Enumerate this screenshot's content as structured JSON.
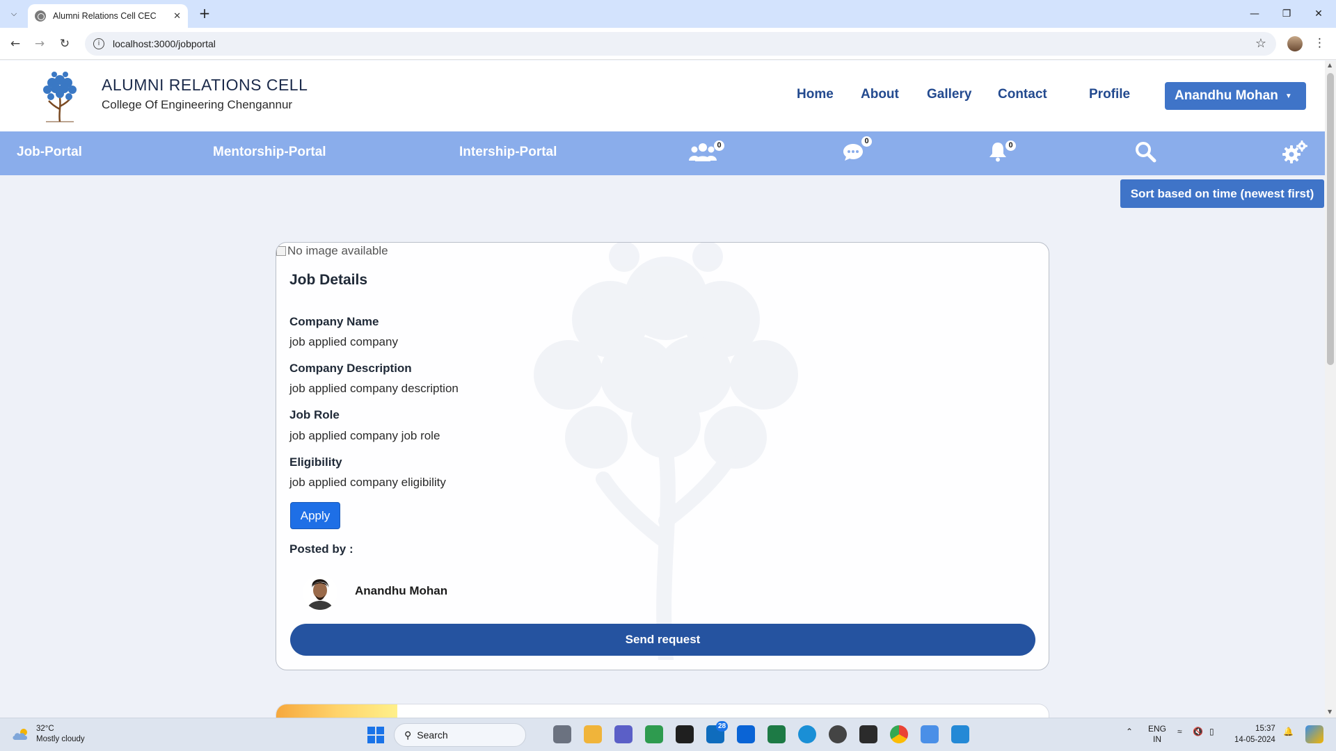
{
  "browser": {
    "tab_title": "Alumni Relations Cell CEC",
    "url": "localhost:3000/jobportal"
  },
  "header": {
    "brand_title": "ALUMNI RELATIONS CELL",
    "brand_subtitle": "College Of Engineering Chengannur",
    "nav": [
      "Home",
      "About",
      "Gallery",
      "Contact",
      "Profile"
    ],
    "user_name": "Anandhu Mohan"
  },
  "portal_bar": {
    "links": [
      "Job-Portal",
      "Mentorship-Portal",
      "Intership-Portal"
    ],
    "connections_count": "0",
    "messages_count": "0",
    "notifications_count": "0",
    "icons": [
      "users-icon",
      "chat-icon",
      "bell-icon",
      "search-icon",
      "gears-icon"
    ]
  },
  "sort_button": "Sort based on time (newest first)",
  "job_card": {
    "image_alt": "No image available",
    "title": "Job Details",
    "fields": [
      {
        "label": "Company Name",
        "value": "job applied company"
      },
      {
        "label": "Company Description",
        "value": "job applied company description"
      },
      {
        "label": "Job Role",
        "value": "job applied company job role"
      },
      {
        "label": "Eligibility",
        "value": "job applied company eligibility"
      }
    ],
    "apply_label": "Apply",
    "posted_by_label": "Posted by :",
    "poster_name": "Anandhu Mohan",
    "send_request_label": "Send request"
  },
  "taskbar": {
    "weather_temp": "32°C",
    "weather_desc": "Mostly cloudy",
    "search_placeholder": "Search",
    "mail_badge": "28",
    "lang_line1": "ENG",
    "lang_line2": "IN",
    "time": "15:37",
    "date": "14-05-2024"
  },
  "colors": {
    "portal_bar": "#8aadeb",
    "primary_button": "#3f74c8",
    "send_button": "#2553a0",
    "apply_button": "#1e6fe6",
    "nav_text": "#234a8f"
  }
}
